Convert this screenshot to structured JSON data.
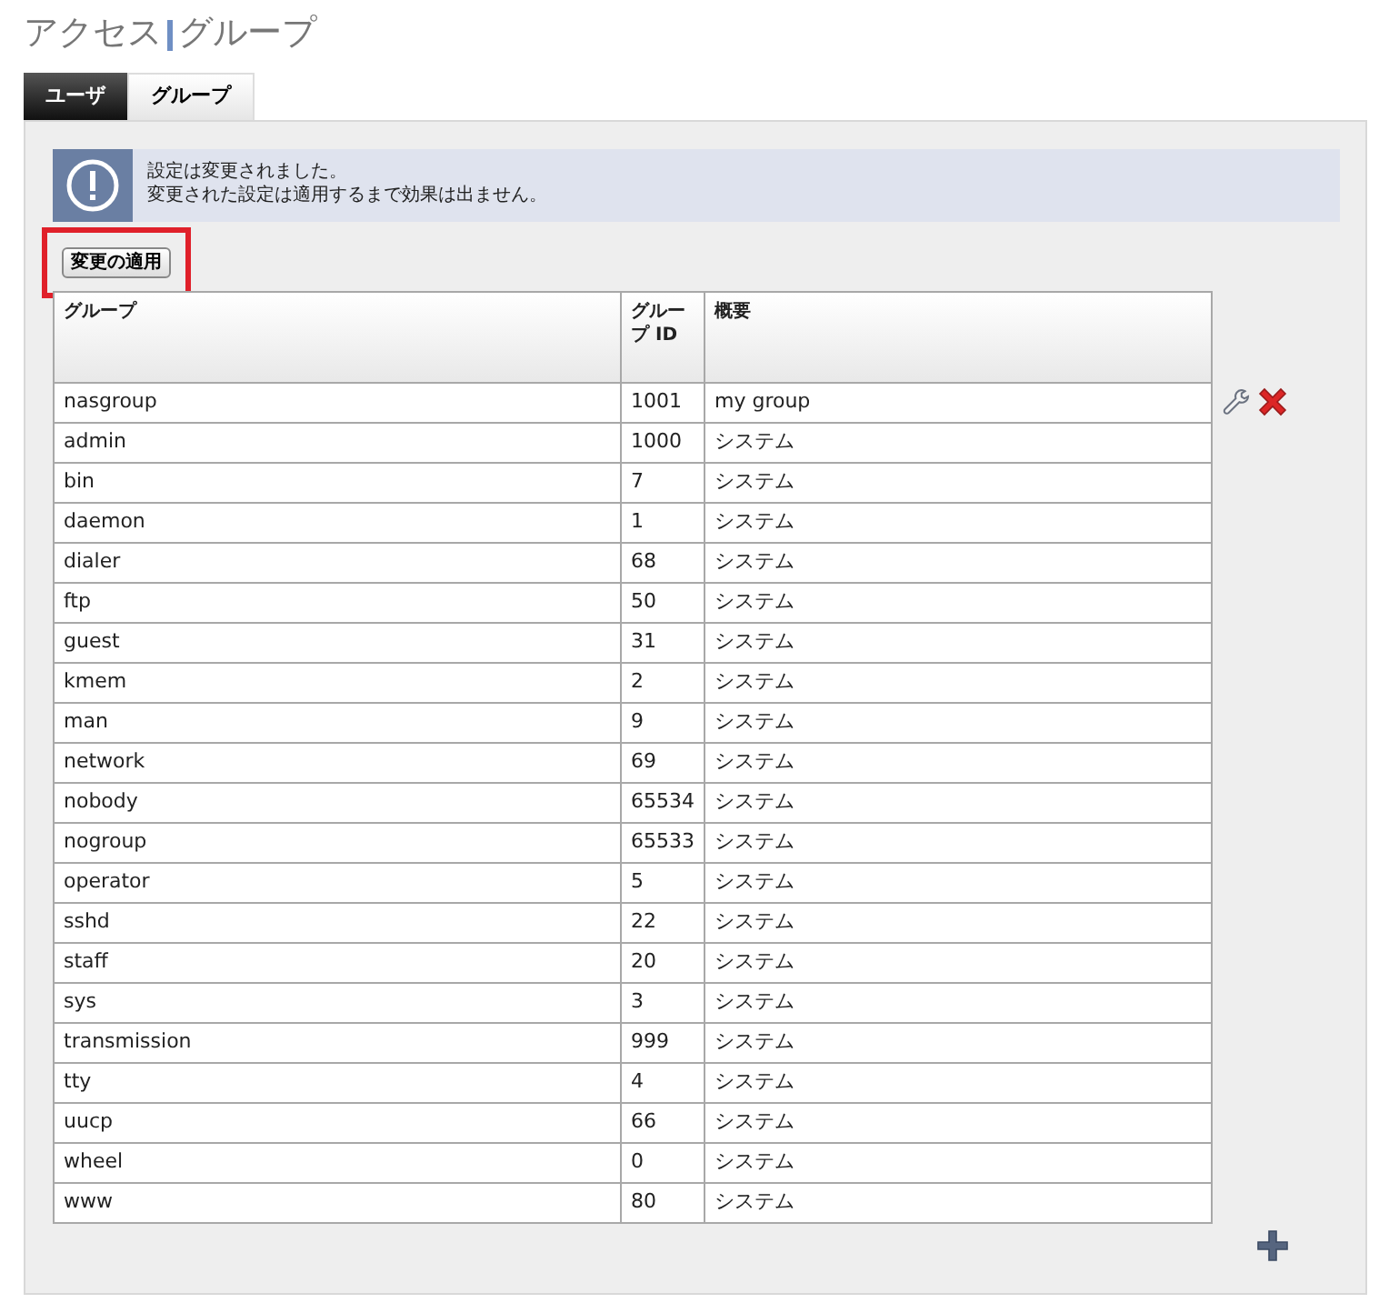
{
  "page_title": {
    "section": "アクセス",
    "page": "グループ"
  },
  "tabs": [
    {
      "label": "ユーザ",
      "selected": true
    },
    {
      "label": "グループ",
      "selected": false
    }
  ],
  "notice": {
    "lines": [
      "設定は変更されました。",
      "変更された設定は適用するまで効果は出ません。"
    ]
  },
  "apply_button": {
    "label": "変更の適用",
    "highlighted": true
  },
  "table": {
    "columns": [
      "グループ",
      "グループ ID",
      "概要"
    ],
    "rows": [
      {
        "cells": [
          "nasgroup",
          "1001",
          "my group"
        ],
        "editable": true
      },
      {
        "cells": [
          "admin",
          "1000",
          "システム"
        ],
        "editable": false
      },
      {
        "cells": [
          "bin",
          "7",
          "システム"
        ],
        "editable": false
      },
      {
        "cells": [
          "daemon",
          "1",
          "システム"
        ],
        "editable": false
      },
      {
        "cells": [
          "dialer",
          "68",
          "システム"
        ],
        "editable": false
      },
      {
        "cells": [
          "ftp",
          "50",
          "システム"
        ],
        "editable": false
      },
      {
        "cells": [
          "guest",
          "31",
          "システム"
        ],
        "editable": false
      },
      {
        "cells": [
          "kmem",
          "2",
          "システム"
        ],
        "editable": false
      },
      {
        "cells": [
          "man",
          "9",
          "システム"
        ],
        "editable": false
      },
      {
        "cells": [
          "network",
          "69",
          "システム"
        ],
        "editable": false
      },
      {
        "cells": [
          "nobody",
          "65534",
          "システム"
        ],
        "editable": false
      },
      {
        "cells": [
          "nogroup",
          "65533",
          "システム"
        ],
        "editable": false
      },
      {
        "cells": [
          "operator",
          "5",
          "システム"
        ],
        "editable": false
      },
      {
        "cells": [
          "sshd",
          "22",
          "システム"
        ],
        "editable": false
      },
      {
        "cells": [
          "staff",
          "20",
          "システム"
        ],
        "editable": false
      },
      {
        "cells": [
          "sys",
          "3",
          "システム"
        ],
        "editable": false
      },
      {
        "cells": [
          "transmission",
          "999",
          "システム"
        ],
        "editable": false
      },
      {
        "cells": [
          "tty",
          "4",
          "システム"
        ],
        "editable": false
      },
      {
        "cells": [
          "uucp",
          "66",
          "システム"
        ],
        "editable": false
      },
      {
        "cells": [
          "wheel",
          "0",
          "システム"
        ],
        "editable": false
      },
      {
        "cells": [
          "www",
          "80",
          "システム"
        ],
        "editable": false
      }
    ]
  }
}
